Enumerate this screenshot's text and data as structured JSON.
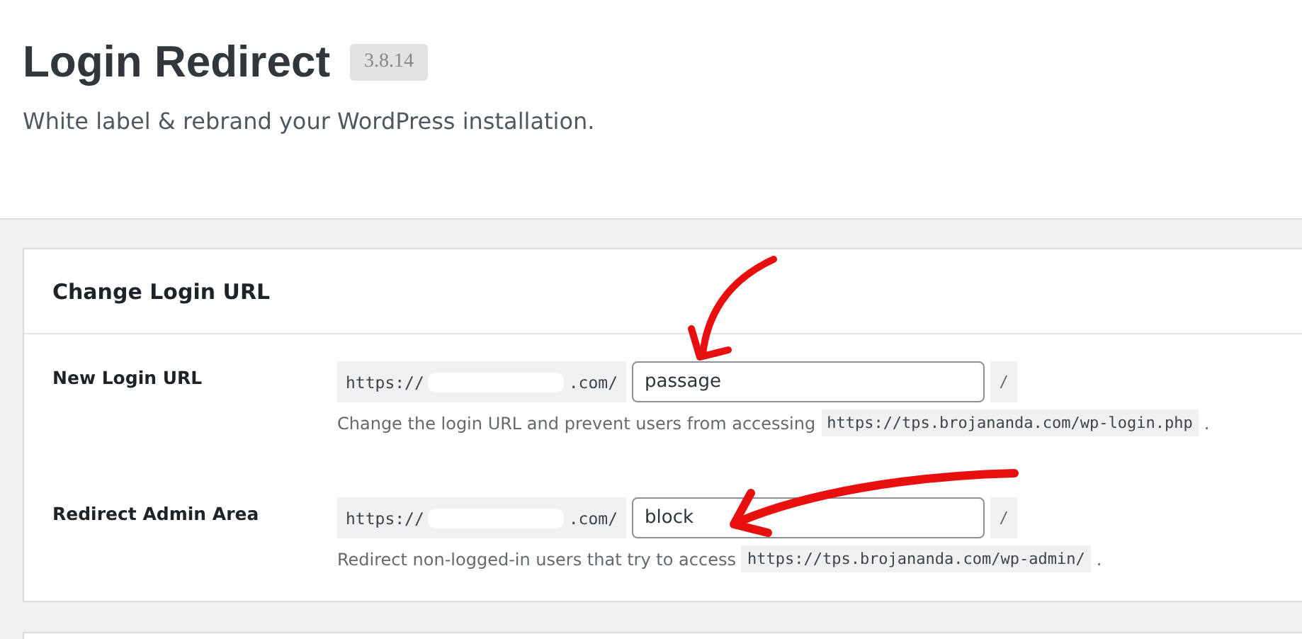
{
  "header": {
    "title": "Login Redirect",
    "version": "3.8.14",
    "subtitle": "White label & rebrand your WordPress installation."
  },
  "section": {
    "title": "Change Login URL",
    "fields": [
      {
        "label": "New Login URL",
        "prefix_start": "https://",
        "prefix_end": ".com/",
        "value": "passage",
        "suffix": "/",
        "description": "Change the login URL and prevent users from accessing",
        "code": "https://tps.brojananda.com/wp-login.php",
        "end": "."
      },
      {
        "label": "Redirect Admin Area",
        "prefix_start": "https://",
        "prefix_end": ".com/",
        "value": "block",
        "suffix": "/",
        "description": "Redirect non-logged-in users that try to access",
        "code": "https://tps.brojananda.com/wp-admin/",
        "end": "."
      }
    ]
  }
}
